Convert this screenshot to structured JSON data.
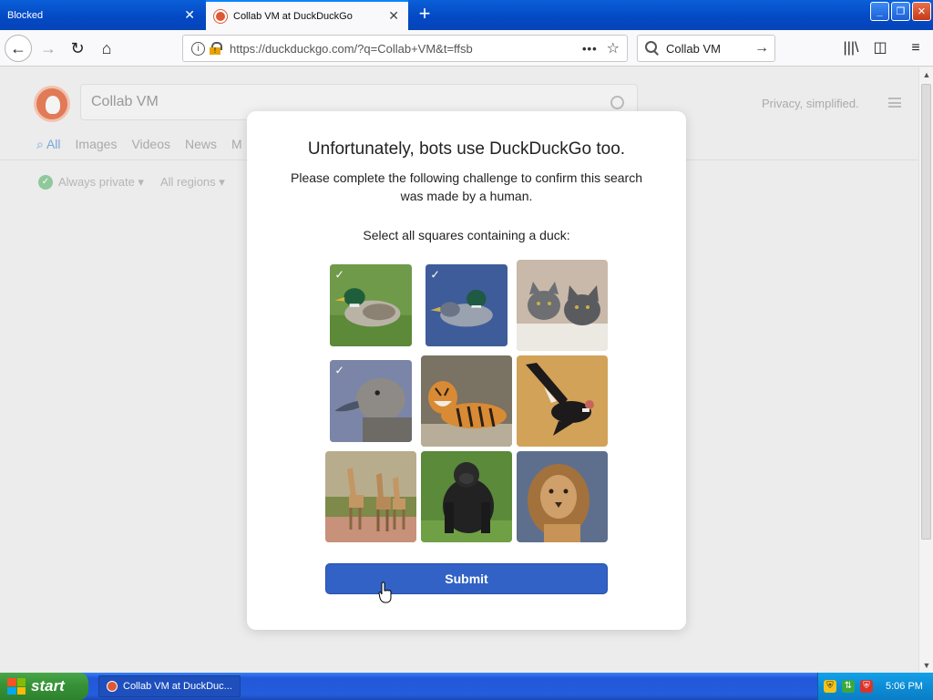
{
  "browser": {
    "tabs": [
      {
        "title": "Blocked",
        "active": false
      },
      {
        "title": "Collab VM at DuckDuckGo",
        "active": true
      }
    ],
    "url": "https://duckduckgo.com/?q=Collab+VM&t=ffsb",
    "search_value": "Collab VM"
  },
  "ddg": {
    "search_value": "Collab VM",
    "tagline": "Privacy, simplified.",
    "tabs": [
      "All",
      "Images",
      "Videos",
      "News",
      "M"
    ],
    "filters": {
      "privacy": "Always private ▾",
      "region": "All regions ▾"
    }
  },
  "challenge": {
    "title": "Unfortunately, bots use DuckDuckGo too.",
    "subtitle": "Please complete the following challenge to confirm this search was made by a human.",
    "prompt": "Select all squares containing a duck:",
    "submit_label": "Submit",
    "tiles": [
      {
        "subject": "mallard-duck",
        "selected": true
      },
      {
        "subject": "mallard-duck",
        "selected": true
      },
      {
        "subject": "cats",
        "selected": false
      },
      {
        "subject": "duck",
        "selected": true
      },
      {
        "subject": "tiger",
        "selected": false
      },
      {
        "subject": "condor",
        "selected": false
      },
      {
        "subject": "giraffes",
        "selected": false
      },
      {
        "subject": "gorilla",
        "selected": false
      },
      {
        "subject": "lion",
        "selected": false
      }
    ]
  },
  "taskbar": {
    "start_label": "start",
    "task_label": "Collab VM at DuckDuc...",
    "clock": "5:06 PM"
  },
  "colors": {
    "submit": "#3262c5",
    "xp_blue": "#245edc",
    "xp_green": "#379437"
  }
}
